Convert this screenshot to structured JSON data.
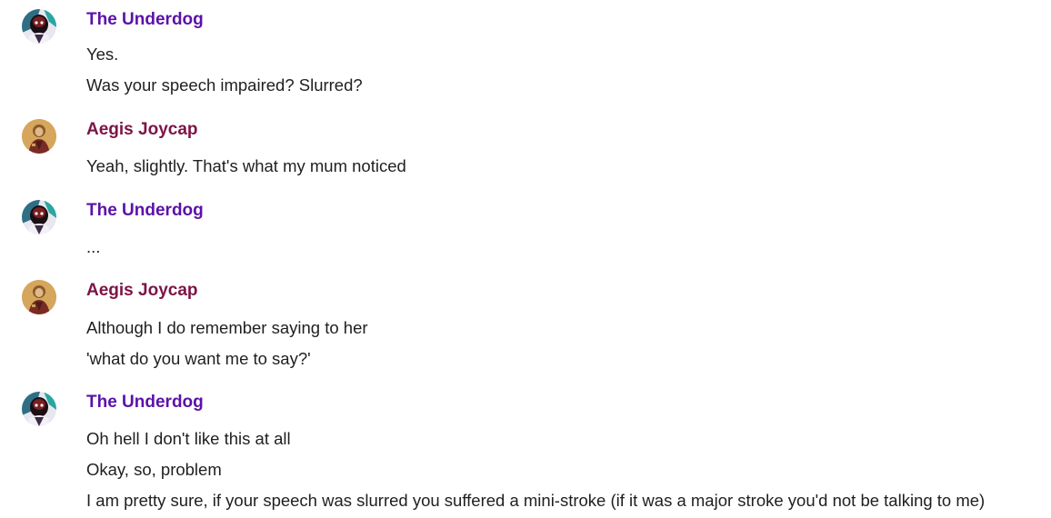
{
  "users": {
    "underdog": {
      "name": "The Underdog",
      "color": "#5b12a8",
      "avatar_icon": "underdog-avatar-icon"
    },
    "aegis": {
      "name": "Aegis Joycap",
      "color": "#7d1446",
      "avatar_icon": "aegis-avatar-icon"
    }
  },
  "messages": [
    {
      "author": "The Underdog",
      "lines": [
        "Yes.",
        "Was your speech impaired? Slurred?"
      ]
    },
    {
      "author": "Aegis Joycap",
      "lines": [
        "Yeah, slightly. That's what my mum noticed"
      ]
    },
    {
      "author": "The Underdog",
      "lines": [
        "..."
      ]
    },
    {
      "author": "Aegis Joycap",
      "lines": [
        "Although I do remember saying to her",
        "'what do you want me to say?'"
      ]
    },
    {
      "author": "The Underdog",
      "lines": [
        "Oh hell I don't like this at all",
        "Okay, so, problem",
        "I am pretty sure, if your speech was slurred you suffered a mini-stroke (if it was a major stroke you'd not be talking to me)"
      ]
    }
  ]
}
